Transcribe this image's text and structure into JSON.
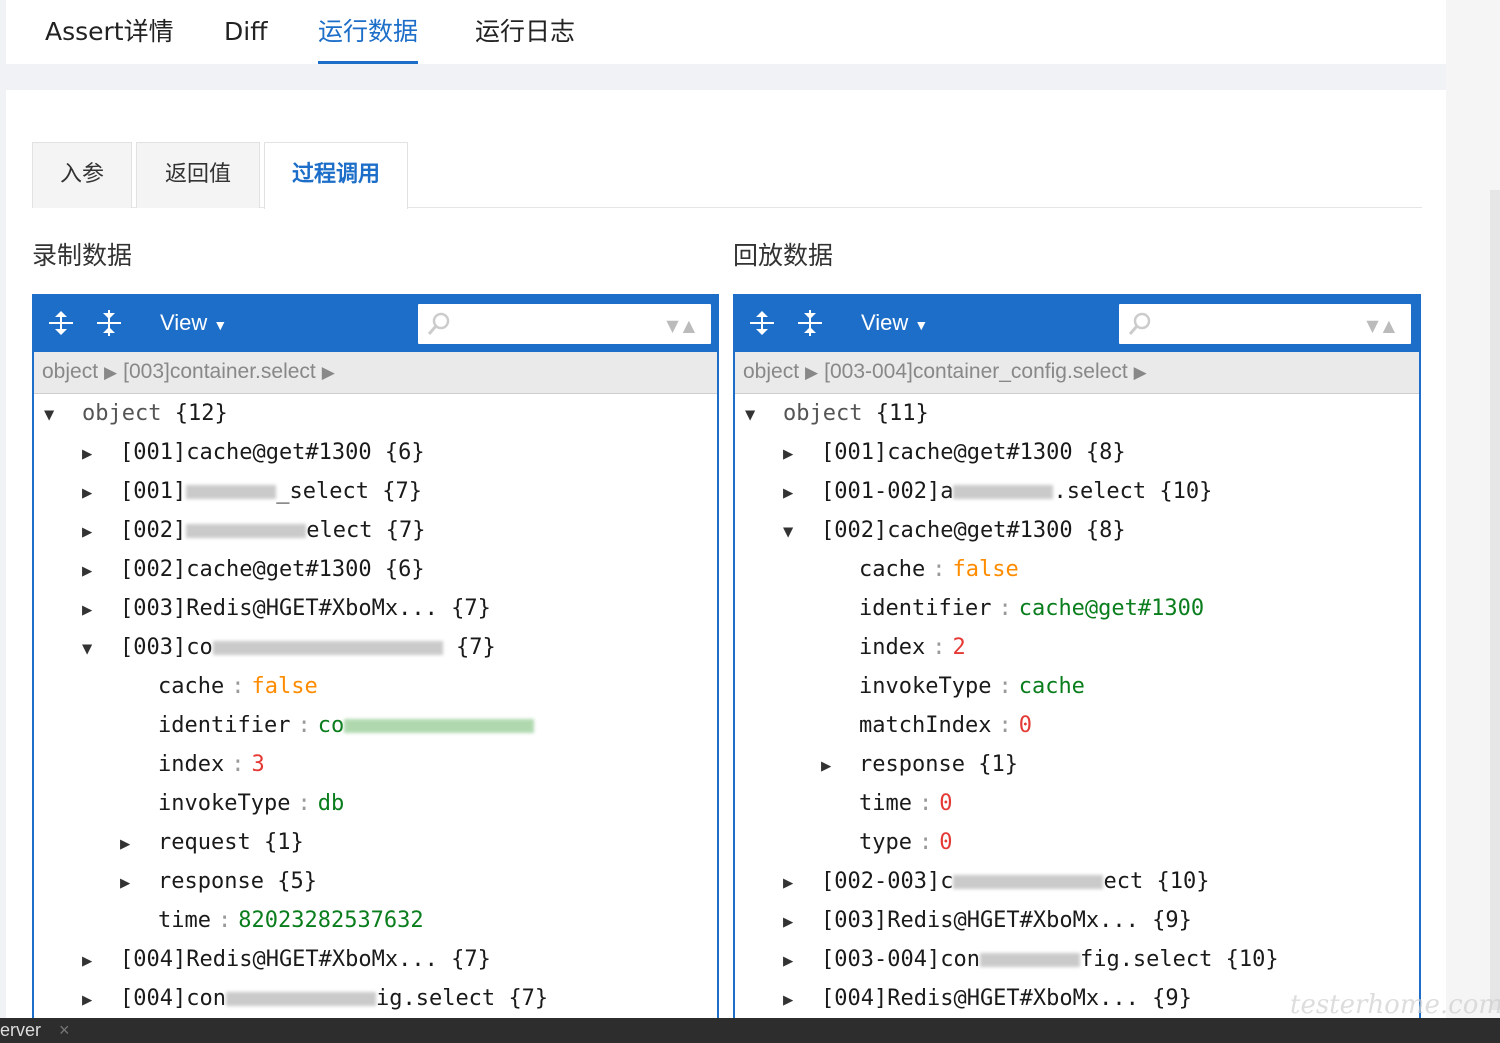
{
  "top_tabs": [
    "Assert详情",
    "Diff",
    "运行数据",
    "运行日志"
  ],
  "sub_tabs": [
    "入参",
    "返回值",
    "过程调用"
  ],
  "left": {
    "title": "录制数据",
    "view_label": "View",
    "breadcrumb": [
      "object",
      "[003]container.select"
    ],
    "root_label": "object",
    "root_count": "{12}",
    "rows": [
      {
        "key": "[001]cache@get#1300",
        "count": "{6}"
      },
      {
        "key": "[001]",
        "count": "{7}",
        "redact": "_select"
      },
      {
        "key": "[002]",
        "count": "{7}",
        "redact": "elect"
      },
      {
        "key": "[002]cache@get#1300",
        "count": "{6}"
      },
      {
        "key": "[003]Redis@HGET#XboMx...",
        "count": "{7}"
      },
      {
        "key": "[003]co",
        "count": "{7}",
        "redact": ""
      },
      {
        "key": "cache",
        "value": "false"
      },
      {
        "key": "identifier",
        "value": "co"
      },
      {
        "key": "index",
        "value": "3"
      },
      {
        "key": "invokeType",
        "value": "db"
      },
      {
        "key": "request",
        "count": "{1}"
      },
      {
        "key": "response",
        "count": "{5}"
      },
      {
        "key": "time",
        "value": "82023282537632"
      },
      {
        "key": "[004]Redis@HGET#XboMx...",
        "count": "{7}"
      },
      {
        "key": "[004]con",
        "count": "{7}",
        "redact": "ig.select"
      }
    ]
  },
  "right": {
    "title": "回放数据",
    "view_label": "View",
    "breadcrumb": [
      "object",
      "[003-004]container_config.select"
    ],
    "root_label": "object",
    "root_count": "{11}",
    "rows": [
      {
        "key": "[001]cache@get#1300",
        "count": "{8}"
      },
      {
        "key": "[001-002]a",
        "count": "{10}",
        "redact": ".select"
      },
      {
        "key": "[002]cache@get#1300",
        "count": "{8}"
      },
      {
        "key": "cache",
        "value": "false"
      },
      {
        "key": "identifier",
        "value": "cache@get#1300"
      },
      {
        "key": "index",
        "value": "2"
      },
      {
        "key": "invokeType",
        "value": "cache"
      },
      {
        "key": "matchIndex",
        "value": "0"
      },
      {
        "key": "response",
        "count": "{1}"
      },
      {
        "key": "time",
        "value": "0"
      },
      {
        "key": "type",
        "value": "0"
      },
      {
        "key": "[002-003]c",
        "count": "{10}",
        "redact": "ect"
      },
      {
        "key": "[003]Redis@HGET#XboMx...",
        "count": "{9}"
      },
      {
        "key": "[003-004]con",
        "count": "{10}",
        "redact": "fig.select"
      },
      {
        "key": "[004]Redis@HGET#XboMx...",
        "count": "{9}"
      }
    ]
  },
  "taskbar": {
    "label": "erver",
    "close": "×"
  },
  "watermark": "testerhome.com",
  "colors": {
    "accent": "#1c6ec9",
    "bool": "#ff8c00",
    "number": "#e53935",
    "string": "#0a7d1d"
  },
  "icons": [
    "expand-all-icon",
    "collapse-all-icon",
    "search-icon",
    "chevron-down-icon",
    "triangle-right-icon",
    "triangle-down-icon"
  ]
}
